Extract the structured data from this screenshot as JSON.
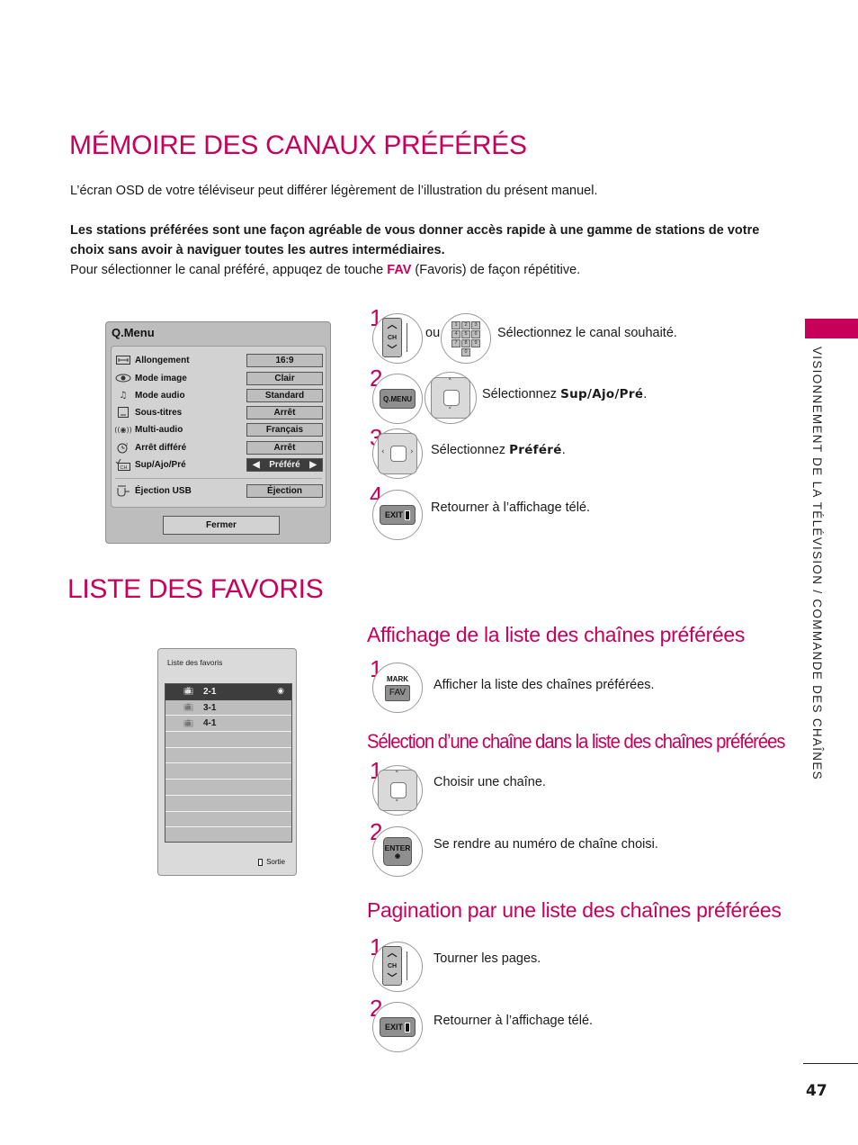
{
  "page": {
    "title": "MÉMOIRE DES CANAUX PRÉFÉRÉS",
    "note": "L’écran OSD de votre téléviseur peut différer légèrement de l’illustration du présent manuel.",
    "intro_bold_line1": "Les stations préférées sont une façon agréable de vous donner accès rapide à une gamme de stations de votre",
    "intro_bold_line2": "choix sans avoir à naviguer toutes les autres intermédiaires.",
    "intro_pre": "Pour sélectionner le canal préféré, appuqez de touche ",
    "intro_fav": "FAV",
    "intro_post": " (Favoris) de façon répétitive.",
    "page_number": "47",
    "accent_color": "#c8005a"
  },
  "sidebar": {
    "section_label": "VISIONNEMENT DE LA TÉLÉVISION / COMMANDE DES CHAÎNES"
  },
  "qmenu": {
    "title": "Q.Menu",
    "rows": [
      {
        "icon": "aspect-ratio-icon",
        "label": "Allongement",
        "value": "16:9"
      },
      {
        "icon": "eye-icon",
        "label": "Mode image",
        "value": "Clair"
      },
      {
        "icon": "music-note-icon",
        "label": "Mode audio",
        "value": "Standard"
      },
      {
        "icon": "subtitle-icon",
        "label": "Sous-titres",
        "value": "Arrêt"
      },
      {
        "icon": "multi-audio-icon",
        "label": "Multi-audio",
        "value": "Français"
      },
      {
        "icon": "sleep-timer-icon",
        "label": "Arrêt différé",
        "value": "Arrêt"
      },
      {
        "icon": "ch-check-icon",
        "label": "Sup/Ajo/Pré",
        "value": "Préféré",
        "selected": true
      }
    ],
    "usb_row": {
      "icon": "usb-eject-icon",
      "label": "Éjection USB",
      "value": "Éjection"
    },
    "close_label": "Fermer",
    "left_arrow": "◀",
    "right_arrow": "▶"
  },
  "memory_steps": [
    {
      "num": "1",
      "button": "CH",
      "alt_connector": "ou",
      "numpad": [
        "1",
        "2",
        "3",
        "4",
        "5",
        "6",
        "7",
        "8",
        "9",
        "0"
      ],
      "text": "Sélectionnez le canal souhaité."
    },
    {
      "num": "2",
      "button": "Q.MENU",
      "text_pre": "Sélectionnez ",
      "text_bold": "Sup/Ajo/Pré",
      "text_post": "."
    },
    {
      "num": "3",
      "button": "left-right-nav",
      "text_pre": "Sélectionnez ",
      "text_bold": "Préféré",
      "text_post": "."
    },
    {
      "num": "4",
      "button": "EXIT",
      "text": "Retourner à l’affichage télé."
    }
  ],
  "favlist_section": {
    "title": "LISTE DES FAVORIS",
    "panel": {
      "title": "Liste des favoris",
      "channels": [
        "2-1",
        "3-1",
        "4-1",
        "",
        "",
        "",
        "",
        "",
        "",
        ""
      ],
      "selected_index": 0,
      "exit_label": "Sortie"
    }
  },
  "display_section": {
    "title": "Affichage de la liste des chaînes préférées",
    "steps": [
      {
        "num": "1",
        "button_top": "MARK",
        "button": "FAV",
        "text": "Afficher la liste des chaînes préférées."
      }
    ]
  },
  "select_section": {
    "title": "Sélection d’une chaîne dans la liste des chaînes préférées",
    "steps": [
      {
        "num": "1",
        "button": "up-down-nav",
        "text": "Choisir une chaîne."
      },
      {
        "num": "2",
        "button": "ENTER",
        "text": "Se rendre au numéro de chaîne choisi."
      }
    ]
  },
  "paging_section": {
    "title": "Pagination par une liste des chaînes préférées",
    "steps": [
      {
        "num": "1",
        "button": "CH",
        "text": "Tourner les pages."
      },
      {
        "num": "2",
        "button": "EXIT",
        "text": "Retourner à l’affichage télé."
      }
    ]
  }
}
